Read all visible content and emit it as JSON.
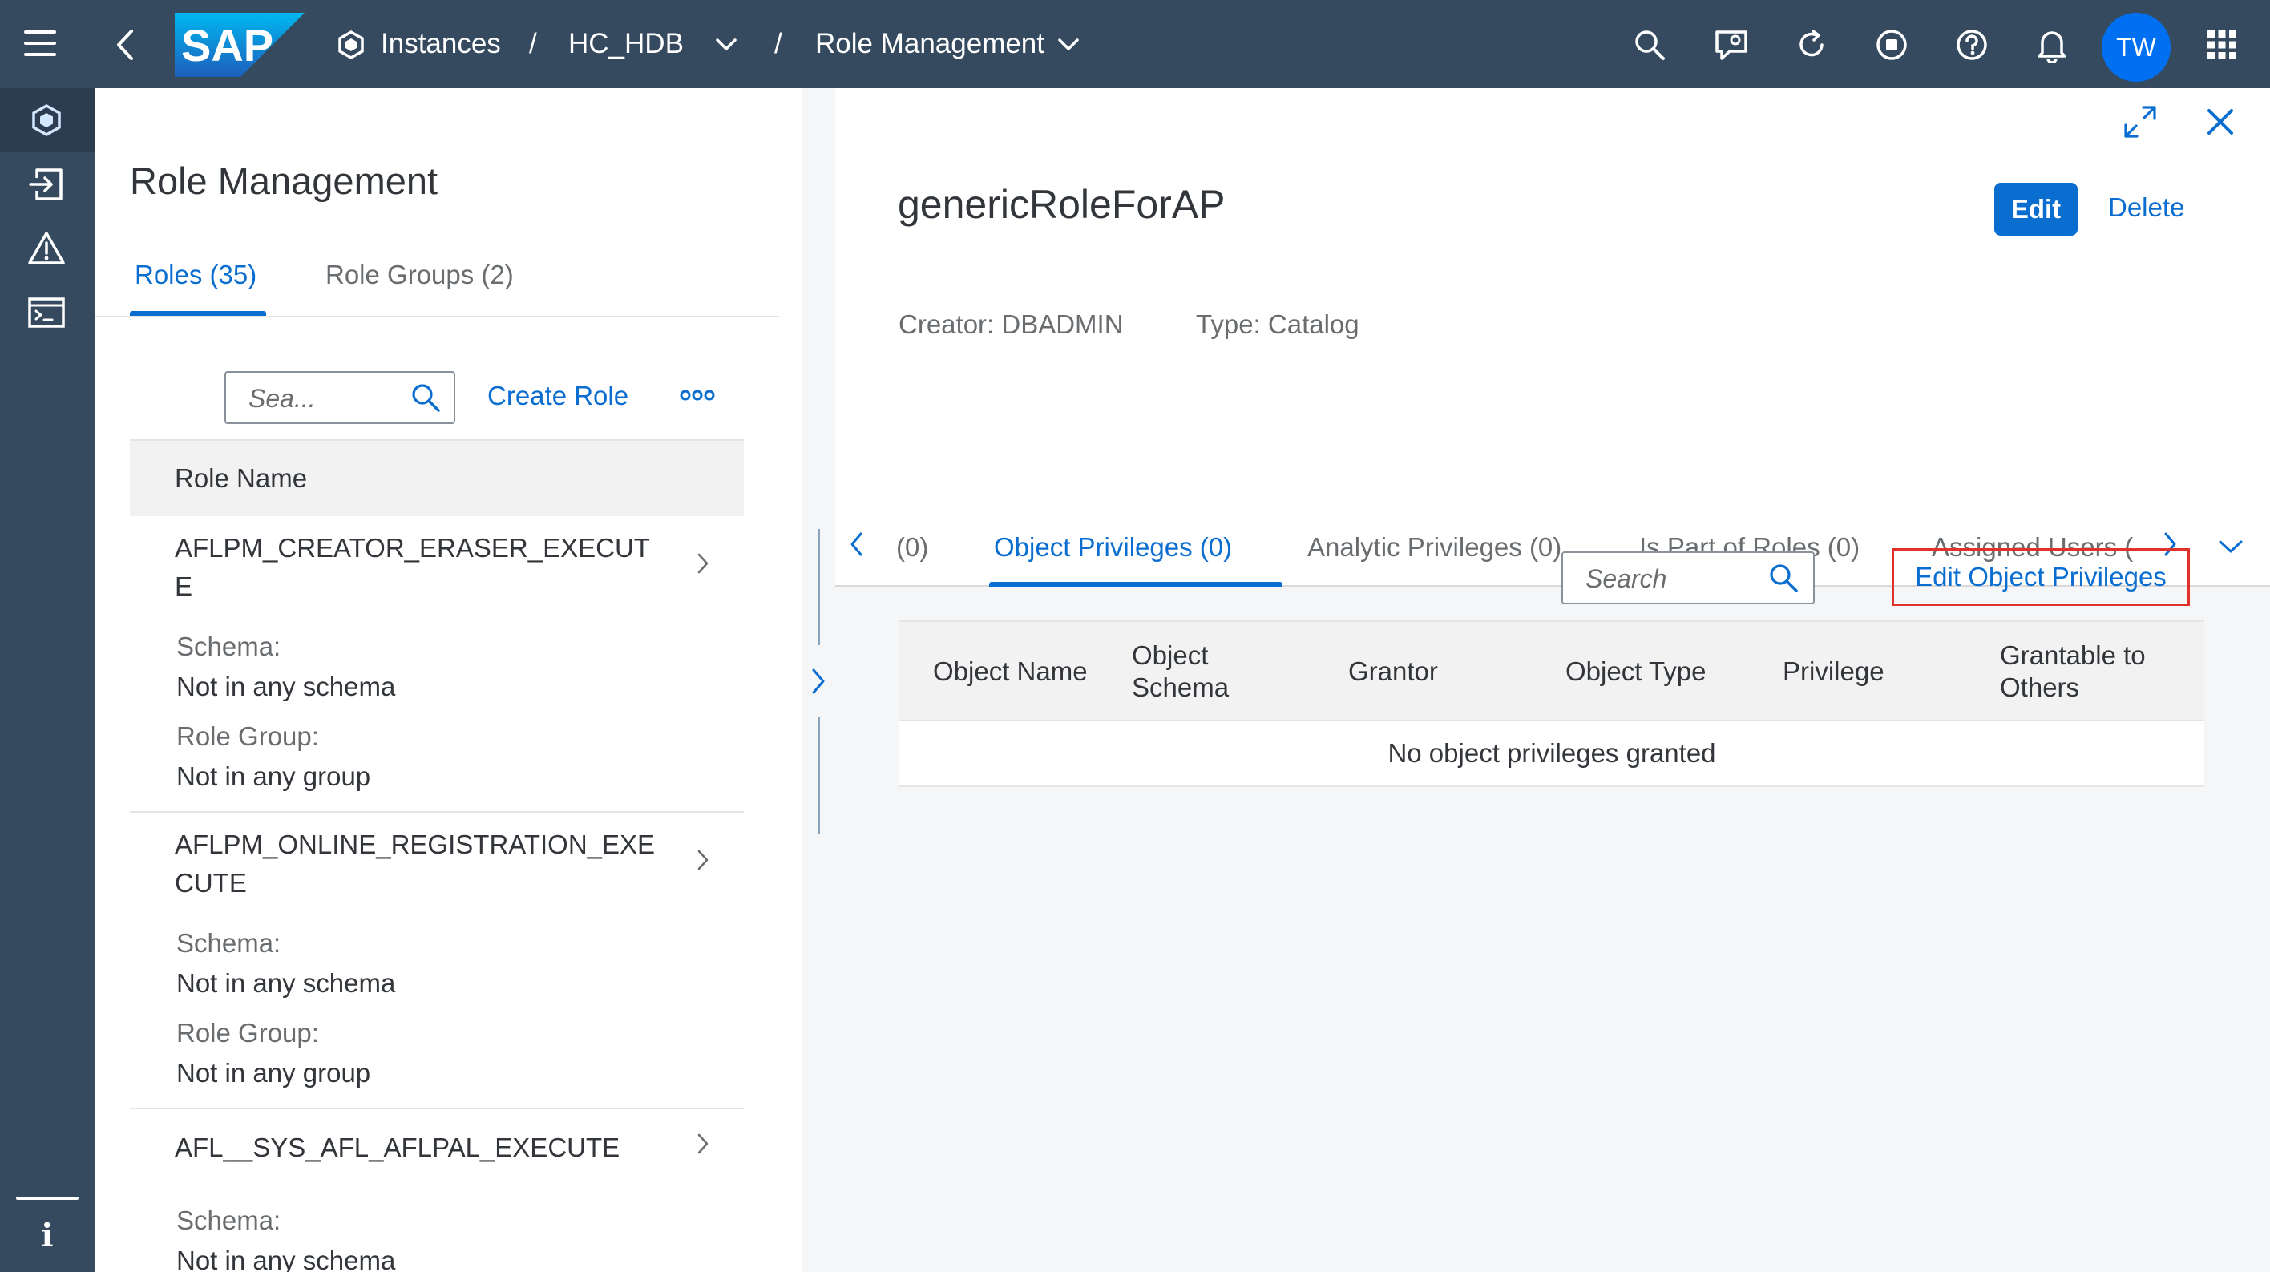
{
  "shell": {
    "logo_text": "SAP",
    "breadcrumb": {
      "instances": "Instances",
      "sep1": "/",
      "instance": "HC_HDB",
      "sep2": "/",
      "app": "Role Management"
    },
    "avatar_initials": "TW",
    "colors": {
      "shell_bg": "#354a5f",
      "accent": "#0a6ed1",
      "avatar_bg": "#0070f2",
      "highlight_box": "#e0312b"
    }
  },
  "sidenav": {
    "items": [
      "instances-icon",
      "import-export-icon",
      "alerts-icon",
      "sql-console-icon"
    ],
    "info": "i"
  },
  "left_panel": {
    "title": "Role Management",
    "tabs": [
      {
        "label": "Roles (35)",
        "active": true
      },
      {
        "label": "Role Groups (2)",
        "active": false
      }
    ],
    "search_placeholder": "Sea...",
    "create_role": "Create Role",
    "column_header": "Role Name",
    "roles": [
      {
        "name": "AFLPM_CREATOR_ERASER_EXECUTE",
        "schema_label": "Schema:",
        "schema_value": "Not in any schema",
        "group_label": "Role Group:",
        "group_value": "Not in any group"
      },
      {
        "name": "AFLPM_ONLINE_REGISTRATION_EXECUTE",
        "schema_label": "Schema:",
        "schema_value": "Not in any schema",
        "group_label": "Role Group:",
        "group_value": "Not in any group"
      },
      {
        "name": "AFL__SYS_AFL_AFLPAL_EXECUTE",
        "schema_label": "Schema:",
        "schema_value": "Not in any schema"
      }
    ]
  },
  "detail": {
    "title": "genericRoleForAP",
    "edit": "Edit",
    "delete": "Delete",
    "creator": "Creator: DBADMIN",
    "type": "Type: Catalog",
    "tabs": [
      {
        "label": "(0)",
        "active": false
      },
      {
        "label": "Object Privileges (0)",
        "active": true
      },
      {
        "label": "Analytic Privileges (0)",
        "active": false
      },
      {
        "label": "Is Part of Roles (0)",
        "active": false
      },
      {
        "label": "Assigned Users (",
        "active": false
      }
    ],
    "search_placeholder": "Search",
    "edit_object_privileges": "Edit Object Privileges",
    "columns": [
      {
        "line1": "Object Name",
        "line2": ""
      },
      {
        "line1": "Object",
        "line2": "Schema"
      },
      {
        "line1": "Grantor",
        "line2": ""
      },
      {
        "line1": "Object Type",
        "line2": ""
      },
      {
        "line1": "Privilege",
        "line2": ""
      },
      {
        "line1": "Grantable to",
        "line2": "Others"
      }
    ],
    "empty_message": "No object privileges granted"
  }
}
